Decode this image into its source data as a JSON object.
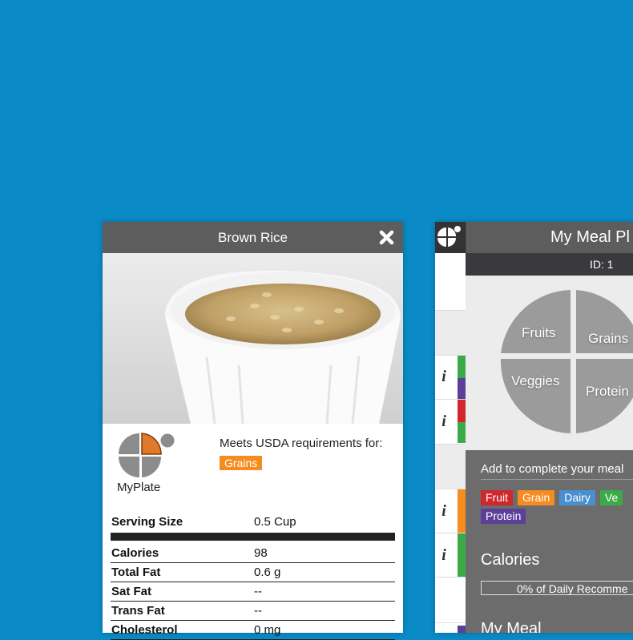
{
  "food": {
    "title": "Brown Rice",
    "myplate_label": "MyPlate",
    "usda_text": "Meets USDA requirements for:",
    "group_badge": "Grains",
    "nutrition": [
      {
        "label": "Serving Size",
        "value": "0.5  Cup"
      },
      {
        "label": "Calories",
        "value": "98"
      },
      {
        "label": "Total Fat",
        "value": "0.6 g"
      },
      {
        "label": "Sat Fat",
        "value": "--"
      },
      {
        "label": "Trans Fat",
        "value": "--"
      },
      {
        "label": "Cholesterol",
        "value": "0 mg"
      }
    ]
  },
  "meal": {
    "title": "My Meal Pl",
    "id_text": "ID: 1",
    "plate": {
      "fruits": "Fruits",
      "grains": "Grains",
      "veggies": "Veggies",
      "protein": "Protein"
    },
    "add_text": "Add to complete your meal",
    "tags": [
      {
        "label": "Fruit",
        "color": "#d0272d"
      },
      {
        "label": "Grain",
        "color": "#f68c1f"
      },
      {
        "label": "Dairy",
        "color": "#4a90d0"
      },
      {
        "label": "Ve",
        "color": "#3daa48"
      },
      {
        "label": "Protein",
        "color": "#5b3f98"
      }
    ],
    "calories_title": "Calories",
    "calories_bar": "0% of Daily Recomme",
    "my_meal_title": "My Meal"
  },
  "sidebar": {
    "info_glyph": "i",
    "stripe_colors": [
      "#3daa48",
      "#5b3f98",
      "#d0272d",
      "#3daa48",
      "#f68c1f",
      "#3daa48",
      "#5b3f98"
    ]
  },
  "colors": {
    "background": "#0a8ac6",
    "header": "#5d5d5d",
    "grains": "#f68c1f"
  }
}
